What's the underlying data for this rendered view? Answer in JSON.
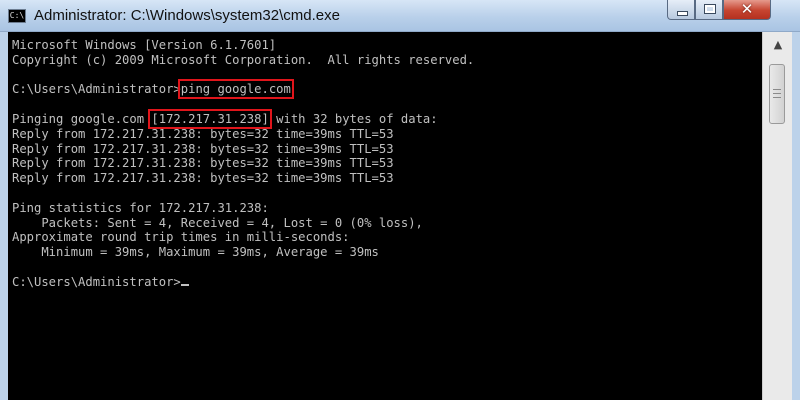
{
  "window": {
    "title": "Administrator: C:\\Windows\\system32\\cmd.exe",
    "icon": "cmd-icon",
    "icon_text": "C:\\",
    "buttons": {
      "minimize_icon": "minimize-icon",
      "maximize_icon": "maximize-icon",
      "close_icon": "close-icon",
      "close_glyph": "✕"
    }
  },
  "console": {
    "lines": [
      "Microsoft Windows [Version 6.1.7601]",
      "Copyright (c) 2009 Microsoft Corporation.  All rights reserved.",
      "",
      {
        "prompt": "C:\\Users\\Administrator>",
        "command": "ping google.com"
      },
      "",
      {
        "before": "Pinging google.com ",
        "ip": "[172.217.31.238]",
        "after": " with 32 bytes of data:"
      },
      "Reply from 172.217.31.238: bytes=32 time=39ms TTL=53",
      "Reply from 172.217.31.238: bytes=32 time=39ms TTL=53",
      "Reply from 172.217.31.238: bytes=32 time=39ms TTL=53",
      "Reply from 172.217.31.238: bytes=32 time=39ms TTL=53",
      "",
      "Ping statistics for 172.217.31.238:",
      "    Packets: Sent = 4, Received = 4, Lost = 0 (0% loss),",
      "Approximate round trip times in milli-seconds:",
      "    Minimum = 39ms, Maximum = 39ms, Average = 39ms",
      "",
      {
        "prompt": "C:\\Users\\Administrator>",
        "cursor": true
      }
    ],
    "colors": {
      "background": "#000000",
      "text": "#c0c0c0",
      "highlight": "#e0151b"
    }
  },
  "scrollbar": {
    "up_icon": "scroll-up-arrow-icon",
    "up_glyph": "▲"
  }
}
